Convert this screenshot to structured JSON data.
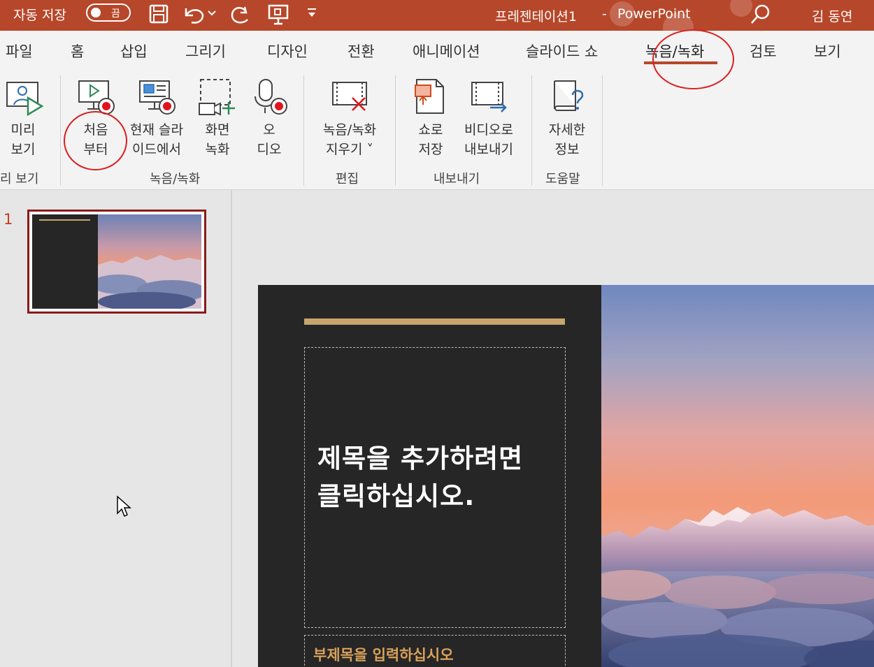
{
  "title_bar": {
    "autosave_label": "자동 저장",
    "autosave_state": "끔",
    "document_title": "프레젠테이션1",
    "separator": "-",
    "app_name": "PowerPoint",
    "user_name": "김 동연",
    "bg_color": "#b7472a"
  },
  "tabs": [
    {
      "label": "파일"
    },
    {
      "label": "홈"
    },
    {
      "label": "삽입"
    },
    {
      "label": "그리기"
    },
    {
      "label": "디자인"
    },
    {
      "label": "전환"
    },
    {
      "label": "애니메이션"
    },
    {
      "label": "슬라이드 쇼"
    },
    {
      "label": "녹음/녹화",
      "active": true
    },
    {
      "label": "검토"
    },
    {
      "label": "보기"
    }
  ],
  "ribbon": {
    "preview": {
      "label": "미리\n보기",
      "group_label": "리 보기"
    },
    "from_beginning": {
      "label": "처음\n부터"
    },
    "from_current": {
      "label": "현재 슬라\n이드에서"
    },
    "screen_recording": {
      "label": "화면\n녹화"
    },
    "audio": {
      "label": "오\n디오"
    },
    "record_group_label": "녹음/녹화",
    "clear_recording": {
      "label": "녹음/녹화\n지우기 ˅"
    },
    "edit_group_label": "편집",
    "save_as_show": {
      "label": "쇼로\n저장"
    },
    "export_video": {
      "label": "비디오로\n내보내기"
    },
    "export_group_label": "내보내기",
    "learn_more": {
      "label": "자세한\n정보"
    },
    "help_group_label": "도움말"
  },
  "thumbnails": [
    {
      "number": "1"
    }
  ],
  "slide": {
    "title_placeholder": "제목을 추가하려면\n클릭하십시오.",
    "subtitle_placeholder": "부제목을 입력하십시오",
    "accent_color": "#c8a46e",
    "panel_color": "#262626",
    "subtitle_color": "#d8a15a"
  },
  "annotations": {
    "circle_color": "#d91e1e"
  }
}
